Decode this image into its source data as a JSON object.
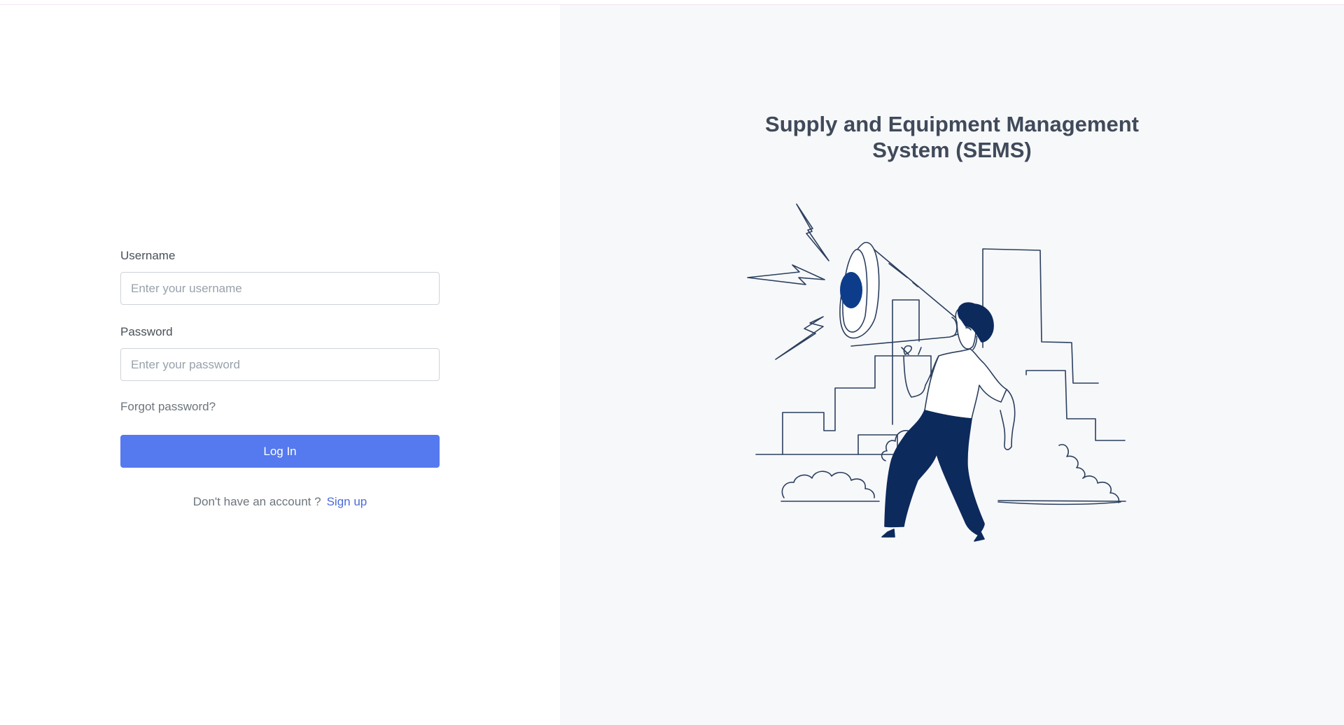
{
  "login": {
    "username_label": "Username",
    "username_placeholder": "Enter your username",
    "password_label": "Password",
    "password_placeholder": "Enter your password",
    "forgot_password": "Forgot password?",
    "login_button": "Log In",
    "signup_prompt": "Don't have an account ?",
    "signup_link": "Sign up"
  },
  "brand": {
    "title_line1": "Supply and Equipment Management",
    "title_line2": "System (SEMS)"
  },
  "illustration": {
    "icon": "person-with-megaphone-icon"
  },
  "colors": {
    "accent": "#5579ee",
    "link": "#4a6bd8",
    "illustration_dark": "#0d2a5c"
  }
}
